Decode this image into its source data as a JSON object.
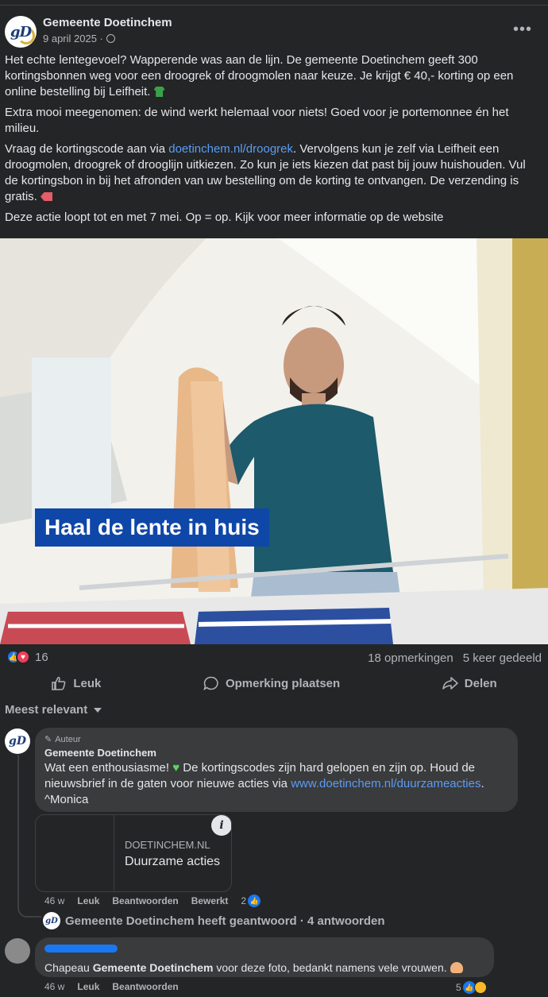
{
  "post": {
    "page_name": "Gemeente Doetinchem",
    "date": "9 april 2025 ·",
    "avatar_logo": "gD",
    "paragraphs": {
      "p1": "Het echte lentegevoel? Wapperende was aan de lijn. De gemeente Doetinchem geeft 300 kortingsbonnen weg voor een droogrek of droogmolen naar keuze. Je krijgt € 40,- korting op een online bestelling bij Leifheit.",
      "p2": "Extra mooi meegenomen: de wind werkt helemaal voor niets! Goed voor je portemonnee én het milieu.",
      "p3_before": "Vraag de kortingscode aan via ",
      "p3_link": "doetinchem.nl/droogrek",
      "p3_after": ". Vervolgens kun je zelf via Leifheit een droogmolen, droogrek of drooglijn uitkiezen. Zo kun je iets kiezen dat past bij jouw huishouden. Vul de kortingsbon in bij het afronden van uw bestelling om de korting te ontvangen. De verzending is gratis.",
      "p4": "Deze actie loopt tot en met 7 mei. Op = op. Kijk voor meer informatie op de website"
    },
    "image_banner": "Haal de lente in huis",
    "reaction_count": "16",
    "comments_count": "18 opmerkingen",
    "shares_count": "5 keer gedeeld"
  },
  "actions": {
    "like": "Leuk",
    "comment": "Opmerking plaatsen",
    "share": "Delen"
  },
  "sort_label": "Meest relevant",
  "comments": {
    "c1": {
      "author_tag": "Auteur",
      "name": "Gemeente Doetinchem",
      "text_before": "Wat een enthousiasme! ",
      "text_mid": " De kortingscodes zijn hard gelopen en zijn op. Houd de nieuwsbrief in de gaten voor nieuwe acties via ",
      "link": "www.doetinchem.nl/duurzameacties",
      "text_after": ". ^Monica",
      "card_domain": "DOETINCHEM.NL",
      "card_title": "Duurzame acties",
      "time": "46 w",
      "like": "Leuk",
      "reply": "Beantwoorden",
      "edit": "Bewerkt",
      "reactions": "2"
    },
    "replied_text": "Gemeente Doetinchem heeft geantwoord · 4 antwoorden",
    "c2": {
      "text_before": "Chapeau ",
      "mention": "Gemeente Doetinchem",
      "text_after": " voor deze foto, bedankt namens vele vrouwen.",
      "time": "46 w",
      "like": "Leuk",
      "reply": "Beantwoorden",
      "reactions": "5"
    }
  },
  "colors": {
    "background": "#242526",
    "link": "#5b9cf5",
    "banner": "#0f47a8",
    "like_blue": "#1877f2",
    "love_red": "#f33e58"
  },
  "icons": [
    "more-icon",
    "globe-icon",
    "like-icon",
    "comment-icon",
    "share-icon",
    "info-icon",
    "pencil-icon"
  ]
}
